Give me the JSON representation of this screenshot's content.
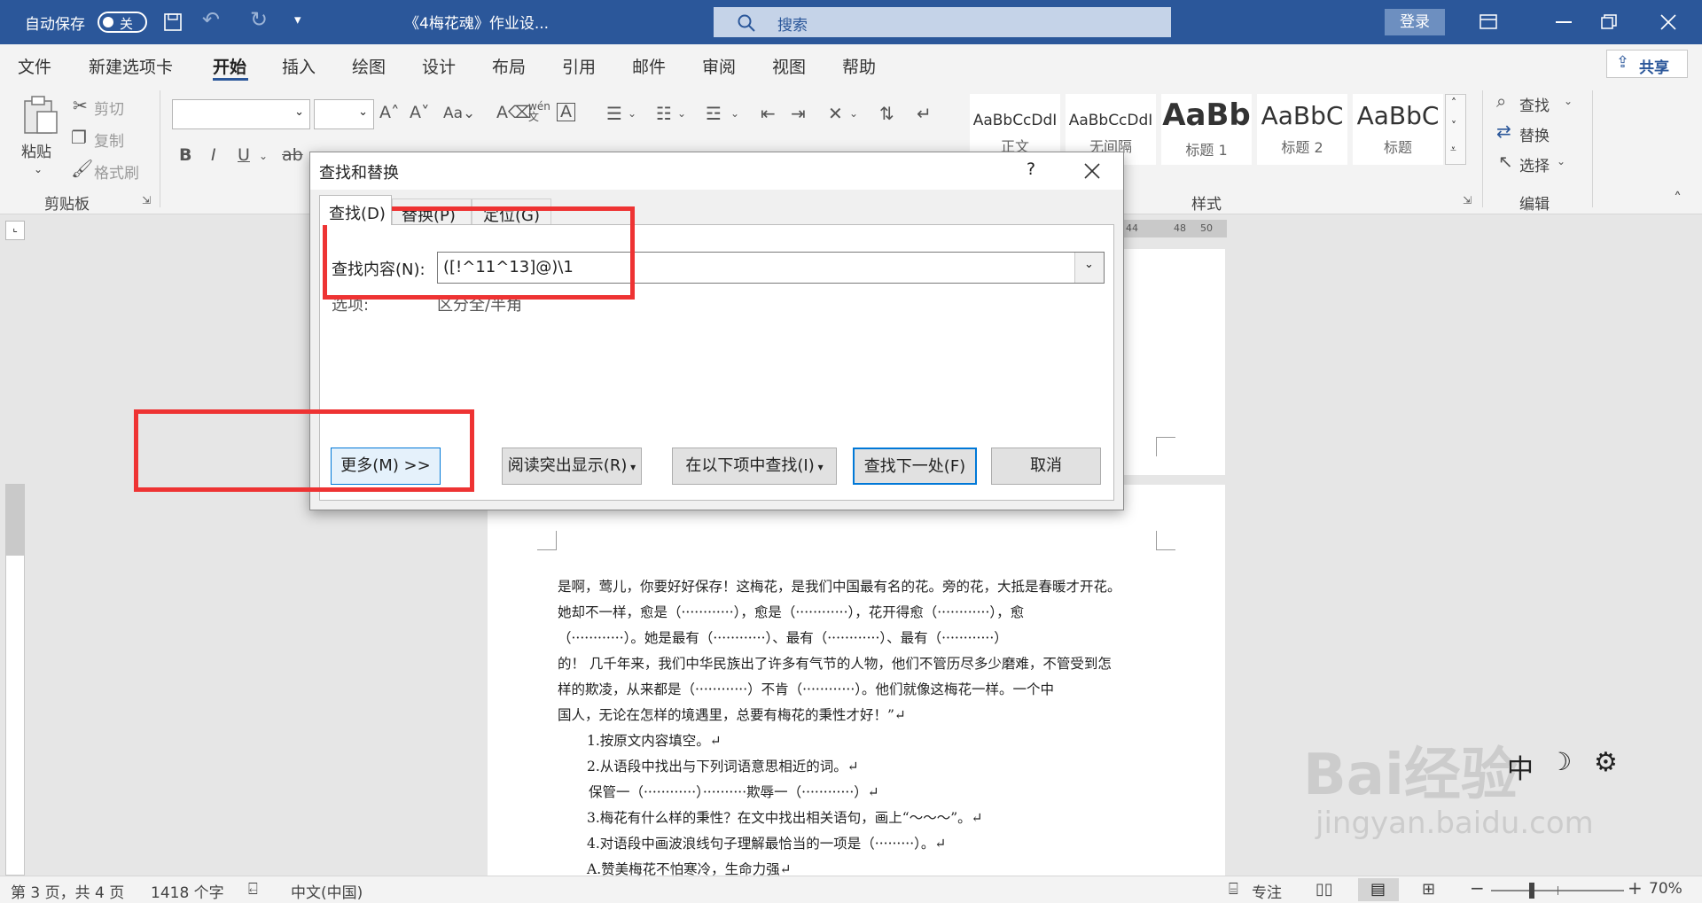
{
  "titlebar": {
    "autosave_label": "自动保存",
    "autosave_state": "关",
    "doc_title": "《4梅花魂》作业设...",
    "search_placeholder": "搜索",
    "login_label": "登录"
  },
  "tabs": [
    "文件",
    "新建选项卡",
    "开始",
    "插入",
    "绘图",
    "设计",
    "布局",
    "引用",
    "邮件",
    "审阅",
    "视图",
    "帮助"
  ],
  "share_label": "共享",
  "ribbon": {
    "paste_label": "粘贴",
    "cut_label": "剪切",
    "copy_label": "复制",
    "format_painter_label": "格式刷",
    "clipboard_group": "剪贴板",
    "styles_group": "样式",
    "editing_group": "编辑",
    "find_label": "查找",
    "replace_label": "替换",
    "select_label": "选择",
    "styles": [
      {
        "sample": "AaBbCcDdI",
        "name": "正文"
      },
      {
        "sample": "AaBbCcDdI",
        "name": "无间隔"
      },
      {
        "sample": "AaBb",
        "name": "标题 1"
      },
      {
        "sample": "AaBbC",
        "name": "标题 2"
      },
      {
        "sample": "AaBbC",
        "name": "标题"
      }
    ]
  },
  "ruler": {
    "marks": [
      "44",
      "48",
      "50"
    ]
  },
  "dialog": {
    "title": "查找和替换",
    "help": "?",
    "tabs": [
      "查找(D)",
      "替换(P)",
      "定位(G)"
    ],
    "find_label": "查找内容(N):",
    "find_value": "([!^11^13]@)\\1",
    "options_label": "选项:",
    "options_value": "区分全/半角",
    "more_button": "更多(M) >>",
    "reading_highlight_button": "阅读突出显示(R)",
    "find_in_button": "在以下项中查找(I)",
    "find_next_button": "查找下一处(F)",
    "cancel_button": "取消"
  },
  "document": {
    "lines": [
      "是啊，莺儿，你要好好保存！这梅花，是我们中国最有名的花。旁的花，大抵是春暖才开花。",
      "她却不一样，愈是（············），愈是（············），花开得愈（············），愈",
      "（············）。她是最有（············）、最有（············）、最有（············）",
      "的！ 几千年来，我们中华民族出了许多有气节的人物，他们不管历尽多少磨难，不管受到怎",
      "样的欺凌，从来都是（············）不肯（············）。他们就像这梅花一样。一个中",
      "国人，无论在怎样的境遇里，总要有梅花的秉性才好！”↵"
    ],
    "items": [
      "1.按原文内容填空。↵",
      "2.从语段中找出与下列词语意思相近的词。↵",
      "保管一（············）··········欺辱一（············）↵",
      "3.梅花有什么样的秉性？在文中找出相关语句，画上“～～～”。↵",
      "4.对语段中画波浪线句子理解最恰当的一项是（·········）。↵",
      "A.赞美梅花不怕寒冷，生命力强↵"
    ]
  },
  "watermark": {
    "text": "Bai经验",
    "url": "jingyan.baidu.com",
    "ime": "中"
  },
  "statusbar": {
    "page": "第 3 页，共 4 页",
    "words": "1418 个字",
    "language": "中文(中国)",
    "focus": "专注",
    "zoom": "70%"
  }
}
